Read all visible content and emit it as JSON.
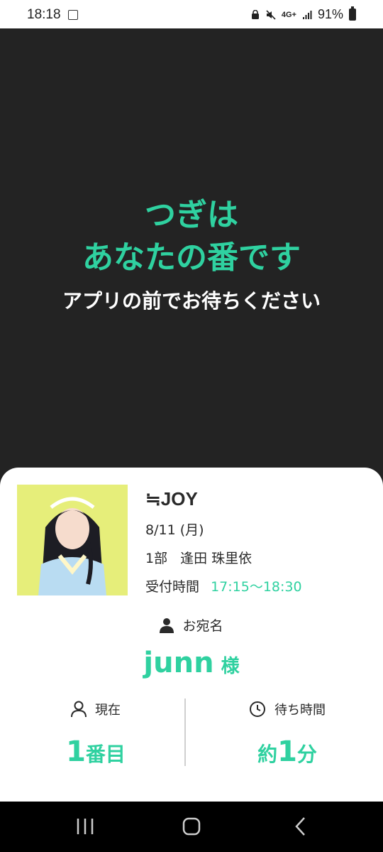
{
  "status_bar": {
    "time": "18:18",
    "network": "4G+",
    "battery": "91%"
  },
  "hero": {
    "line1": "つぎは",
    "line2": "あなたの番です",
    "subtitle": "アプリの前でお待ちください"
  },
  "ticket": {
    "group_logo": "≒JOY",
    "date": "8/11 (月)",
    "session": "1部",
    "member": "逢田 珠里依",
    "reception_label": "受付時間",
    "reception_time": "17:15〜18:30",
    "address_label": "お宛名",
    "name": "junn",
    "honorific": "様",
    "current_label": "現在",
    "current_value": "1",
    "current_unit": "番目",
    "wait_label": "待ち時間",
    "wait_prefix": "約",
    "wait_value": "1",
    "wait_unit": "分"
  },
  "colors": {
    "accent": "#2fd1a0",
    "hero_bg": "#232323",
    "card_bg": "#ffffff"
  },
  "icons": [
    "qr-icon",
    "person-icon",
    "clock-icon",
    "recent-apps-icon",
    "home-icon",
    "back-icon"
  ]
}
